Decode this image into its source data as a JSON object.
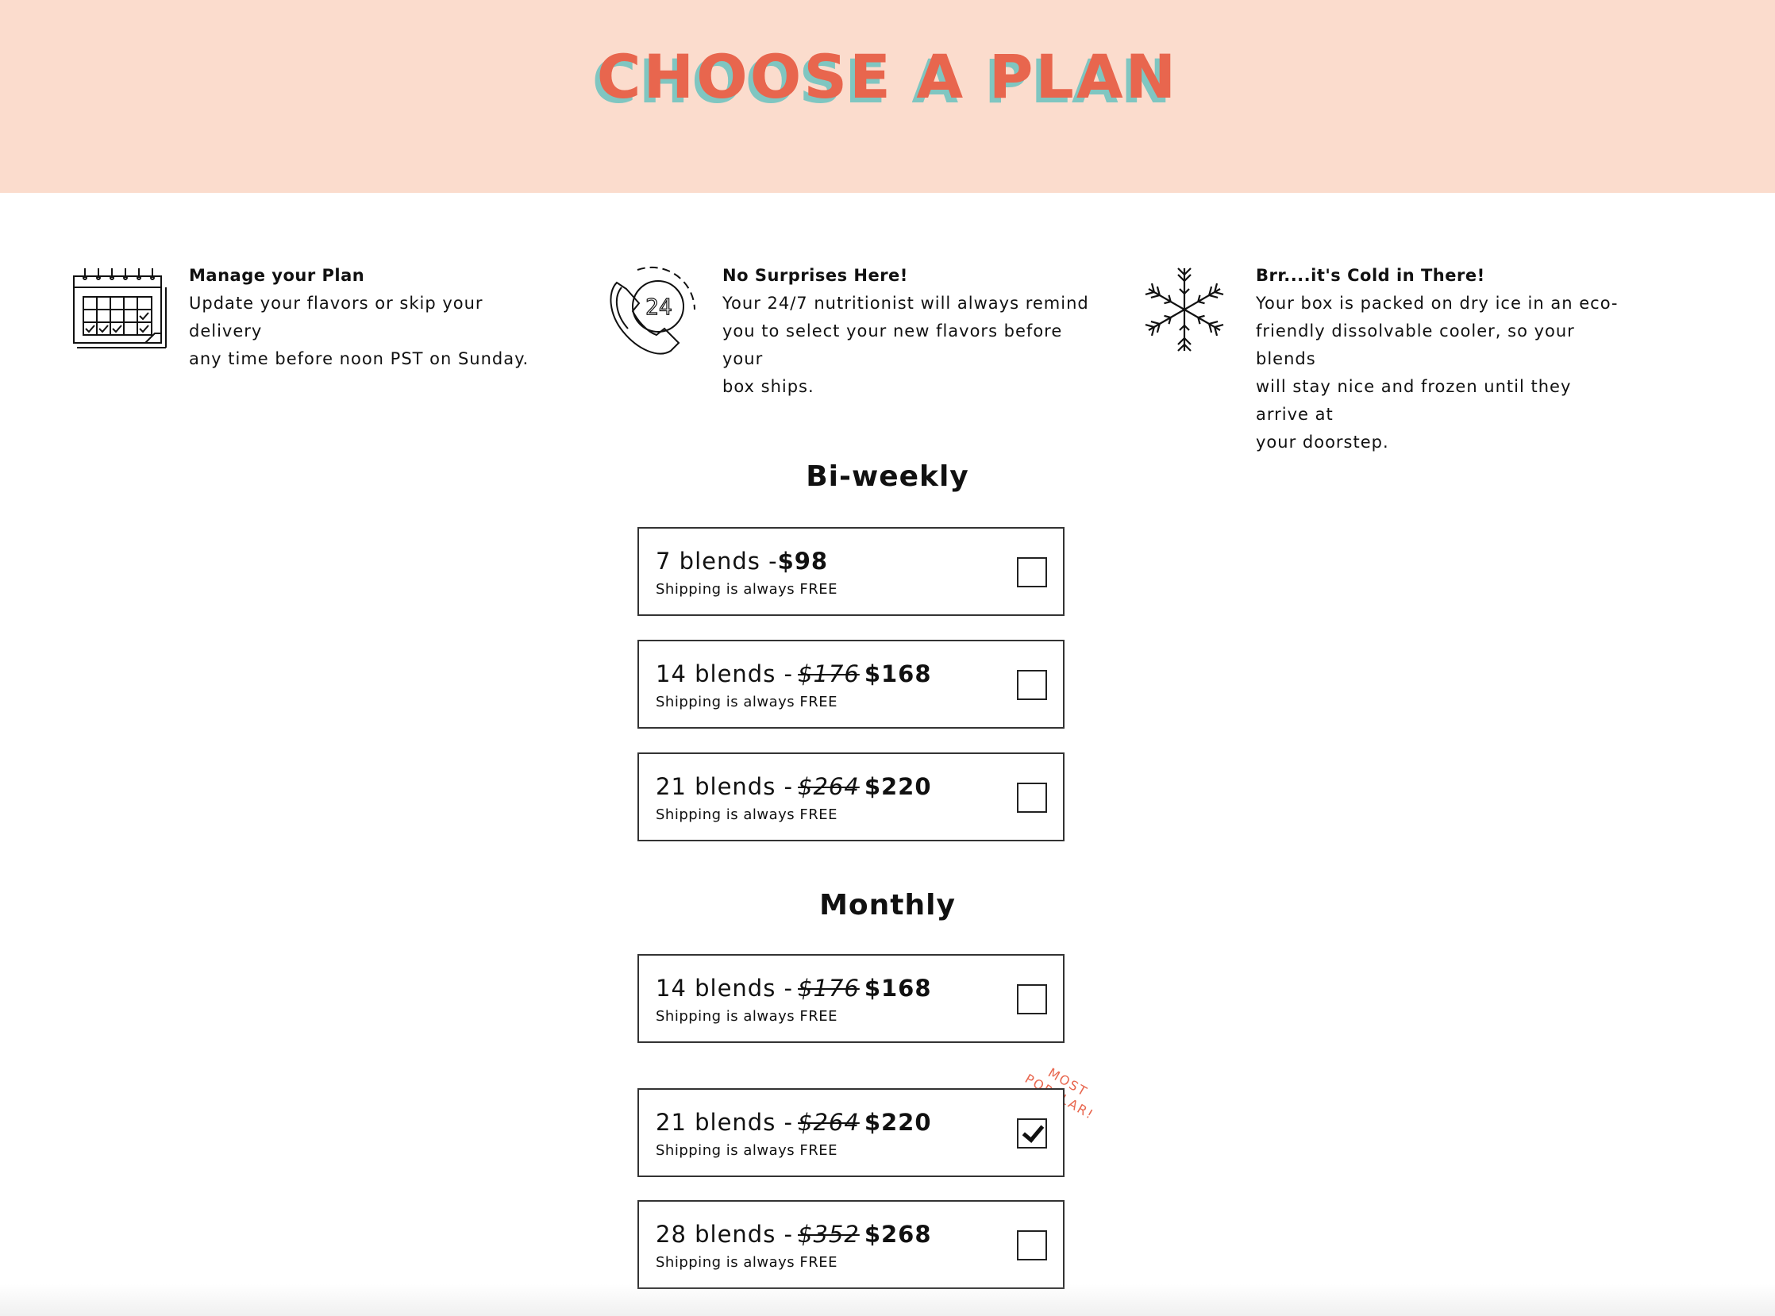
{
  "header": {
    "title": "CHOOSE A PLAN",
    "title_color": "#e8664e",
    "shadow_color": "#7fc6c1",
    "background": "#fbdccd"
  },
  "features": [
    {
      "icon": "calendar-icon",
      "title": "Manage your Plan",
      "lines": [
        "Update your flavors or skip your delivery",
        "any time before noon PST on Sunday."
      ]
    },
    {
      "icon": "phone-24-icon",
      "title": "No Surprises Here!",
      "lines": [
        "Your 24/7 nutritionist will always remind",
        "you to select your new flavors before your",
        "box ships."
      ]
    },
    {
      "icon": "snowflake-icon",
      "title": "Brr....it's Cold in There!",
      "lines": [
        "Your box is packed on dry ice in an eco-",
        "friendly dissolvable cooler, so your blends",
        "will stay nice and frozen until they arrive at",
        "your doorstep."
      ]
    }
  ],
  "biweekly": {
    "title": "Bi-weekly",
    "plans": [
      {
        "blends": "7 blends -",
        "old": "",
        "price": "$98",
        "shipping": "Shipping is always FREE",
        "checked": false
      },
      {
        "blends": "14 blends -",
        "old": "$176",
        "price": "$168",
        "shipping": "Shipping is always FREE",
        "checked": false
      },
      {
        "blends": "21 blends -",
        "old": "$264",
        "price": "$220",
        "shipping": "Shipping is always FREE",
        "checked": false
      }
    ]
  },
  "monthly": {
    "title": "Monthly",
    "plans": [
      {
        "blends": "14 blends -",
        "old": "$176",
        "price": "$168",
        "shipping": "Shipping is always FREE",
        "checked": false
      },
      {
        "blends": "21 blends -",
        "old": "$264",
        "price": "$220",
        "shipping": "Shipping is always FREE",
        "checked": true
      },
      {
        "blends": "28 blends -",
        "old": "$352",
        "price": "$268",
        "shipping": "Shipping is always FREE",
        "checked": false
      }
    ],
    "badge": [
      "MOST",
      "POPULAR!"
    ]
  }
}
